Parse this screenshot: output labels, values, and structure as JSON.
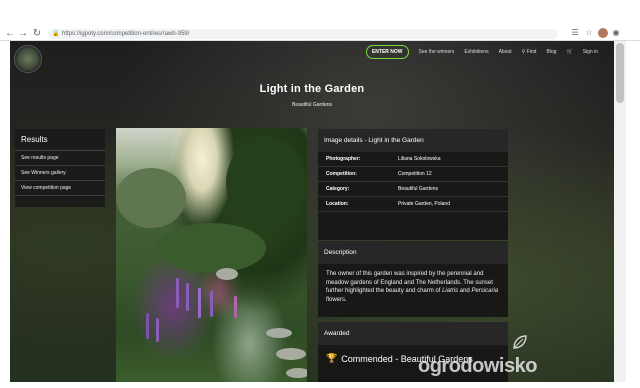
{
  "browser": {
    "url": "https://igpoty.com/competition-entries/rawb-959/",
    "back_icon": "arrow-left-icon",
    "forward_icon": "arrow-right-icon",
    "reload_icon": "reload-icon"
  },
  "nav": {
    "enter": "ENTER NOW",
    "links": [
      "See the winners",
      "Exhibitions",
      "About",
      "Find",
      "Blog",
      "Sign in"
    ]
  },
  "hero": {
    "title": "Light in the Garden",
    "subtitle": "Beautiful Gardens"
  },
  "results": {
    "heading": "Results",
    "items": [
      "See results page",
      "See Winners gallery",
      "View competition page"
    ]
  },
  "details": {
    "heading": "Image details - Light in the Garden",
    "rows": [
      {
        "key": "Photographer:",
        "value": "Liliana Sokolowska"
      },
      {
        "key": "Competition:",
        "value": "Competition 12"
      },
      {
        "key": "Category:",
        "value": "Beautiful Gardens"
      },
      {
        "key": "Location:",
        "value": "Private Garden, Poland"
      }
    ]
  },
  "description": {
    "heading": "Description",
    "text_before": "The owner of this garden was inspired by the perennial and meadow gardens of England and The Netherlands. The sunset further highlighted the beauty and charm of ",
    "italic1": "Liatris",
    "text_mid": " and ",
    "italic2": "Persicaria",
    "text_after": " flowers."
  },
  "awarded": {
    "heading": "Awarded",
    "award": "Commended - Beautiful Gardens"
  },
  "watermark": "ogrodowisko"
}
